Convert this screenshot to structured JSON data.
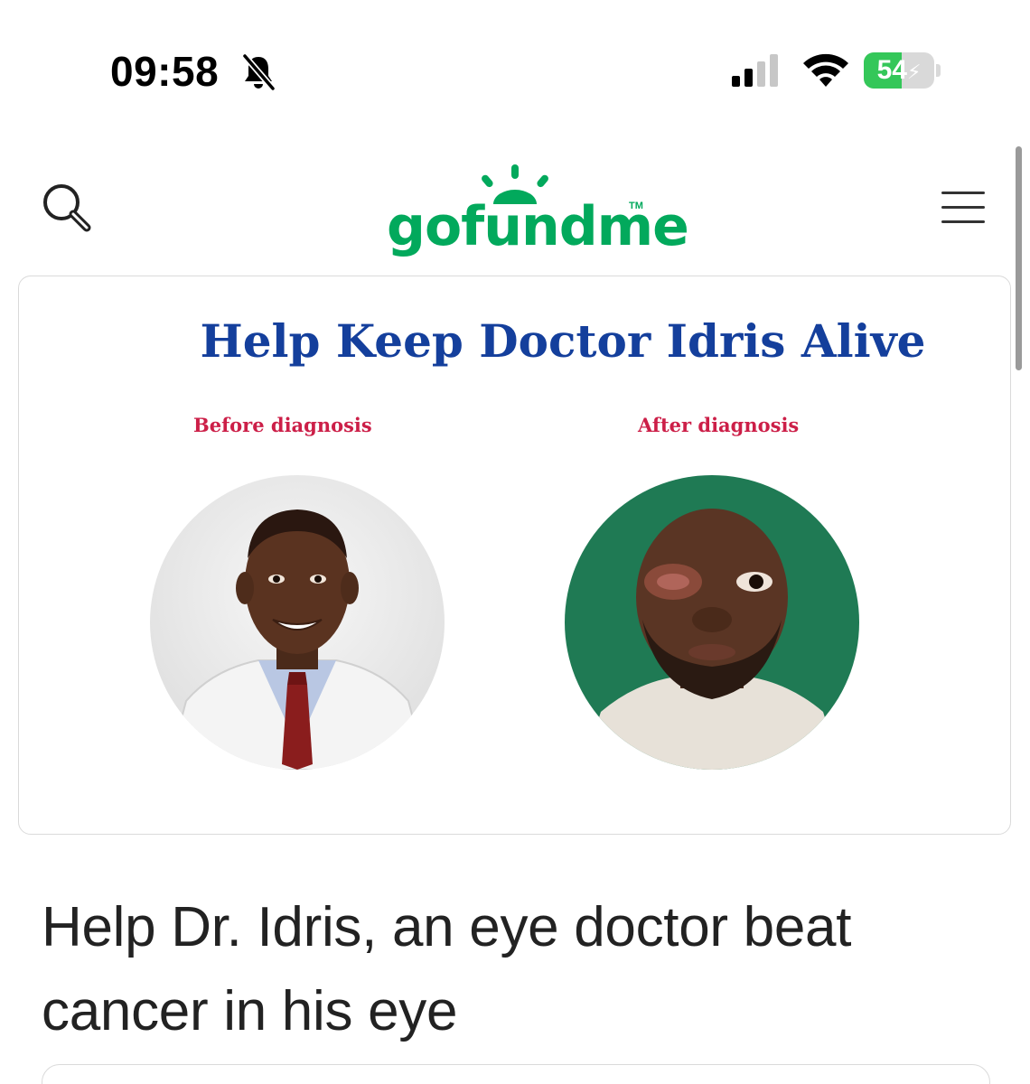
{
  "status_bar": {
    "time": "09:58",
    "silent_icon": "bell-slash-icon",
    "signal_icon": "cellular-signal-icon",
    "wifi_icon": "wifi-icon",
    "battery_percent": "54",
    "battery_level": 0.54,
    "battery_color": "#34c759",
    "battery_state": "charging"
  },
  "header": {
    "search_icon": "search-icon",
    "logo_text": "gofundme",
    "logo_tm": "TM",
    "logo_color": "#02a95c",
    "menu_icon": "hamburger-menu-icon"
  },
  "hero_image": {
    "title": "Help Keep Doctor Idris Alive",
    "title_color": "#143f9c",
    "caption_before": "Before diagnosis",
    "caption_after": "After diagnosis",
    "caption_color": "#cc1f48"
  },
  "campaign": {
    "title": "Help Dr. Idris, an eye doctor beat cancer in his eye"
  }
}
